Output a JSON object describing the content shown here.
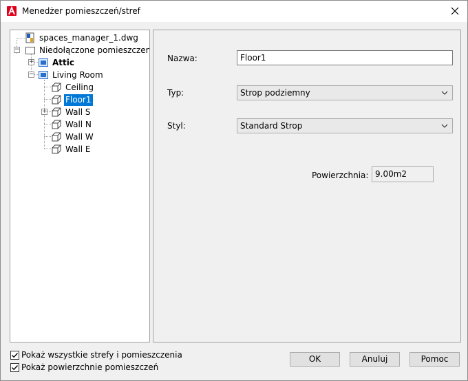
{
  "window": {
    "title": "Menedżer pomieszczeń/stref"
  },
  "tree": {
    "root": "spaces_manager_1.dwg",
    "group": "Niedołączone pomieszczenia",
    "items": [
      {
        "label": "Attic"
      },
      {
        "label": "Living Room"
      },
      {
        "label": "Ceiling"
      },
      {
        "label": "Floor1"
      },
      {
        "label": "Wall S"
      },
      {
        "label": "Wall N"
      },
      {
        "label": "Wall W"
      },
      {
        "label": "Wall E"
      }
    ]
  },
  "form": {
    "name_label": "Nazwa:",
    "name_value": "Floor1",
    "type_label": "Typ:",
    "type_value": "Strop podziemny",
    "style_label": "Styl:",
    "style_value": "Standard Strop",
    "area_label": "Powierzchnia:",
    "area_value": "9.00m2"
  },
  "options": {
    "show_all": "Pokaż wszystkie strefy i pomieszczenia",
    "show_surfaces": "Pokaż powierzchnie pomieszczeń"
  },
  "buttons": {
    "ok": "OK",
    "cancel": "Anuluj",
    "help": "Pomoc"
  },
  "colors": {
    "selection": "#0078d7",
    "app_icon": "#e0001b"
  }
}
